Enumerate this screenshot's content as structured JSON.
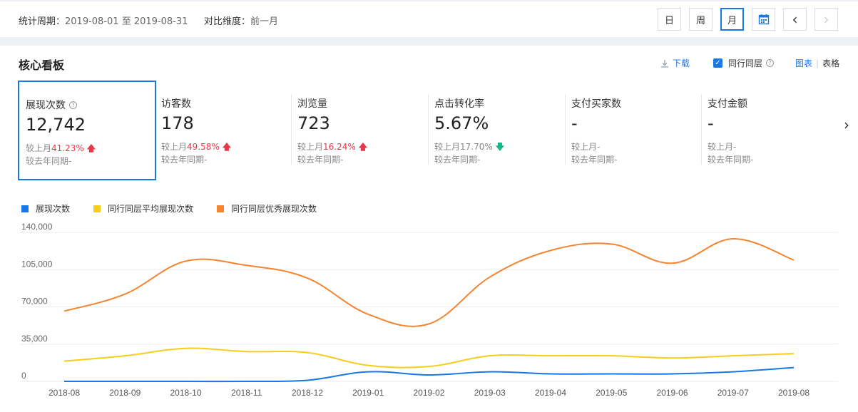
{
  "filters": {
    "period_label": "统计周期：",
    "period_value": "2019-08-01 至 2019-08-31",
    "compare_label": "对比维度：",
    "compare_value": "前一月"
  },
  "toolbar": {
    "day": "日",
    "week": "周",
    "month": "月",
    "prev": "‹",
    "next": "›"
  },
  "panel": {
    "title": "核心看板",
    "download": "下载",
    "peer_label": "同行同层",
    "view_chart": "图表",
    "view_sep": "|",
    "view_table": "表格"
  },
  "cards": [
    {
      "title": "展现次数",
      "value": "12,742",
      "mom_label": "较上月",
      "mom_pct": "41.23%",
      "trend": "up",
      "yoy_label": "较去年同期",
      "yoy_value": "-"
    },
    {
      "title": "访客数",
      "value": "178",
      "mom_label": "较上月",
      "mom_pct": "49.58%",
      "trend": "up",
      "yoy_label": "较去年同期",
      "yoy_value": "-"
    },
    {
      "title": "浏览量",
      "value": "723",
      "mom_label": "较上月",
      "mom_pct": "16.24%",
      "trend": "up",
      "yoy_label": "较去年同期",
      "yoy_value": "-"
    },
    {
      "title": "点击转化率",
      "value": "5.67%",
      "mom_label": "较上月",
      "mom_pct": "17.70%",
      "trend": "down",
      "yoy_label": "较去年同期",
      "yoy_value": "-"
    },
    {
      "title": "支付买家数",
      "value": "-",
      "mom_label": "较上月",
      "mom_pct": "-",
      "trend": "none",
      "yoy_label": "较去年同期",
      "yoy_value": "-"
    },
    {
      "title": "支付金额",
      "value": "-",
      "mom_label": "较上月",
      "mom_pct": "-",
      "trend": "none",
      "yoy_label": "较去年同期",
      "yoy_value": "-"
    }
  ],
  "colors": {
    "accent": "#1a78e6",
    "up": "#e8394a",
    "down": "#17b58a",
    "series1": "#1a78e6",
    "series2": "#f5cd1d",
    "series3": "#f5832f"
  },
  "chart_data": {
    "type": "line",
    "x": [
      "2018-08",
      "2018-09",
      "2018-10",
      "2018-11",
      "2018-12",
      "2019-01",
      "2019-02",
      "2019-03",
      "2019-04",
      "2019-05",
      "2019-06",
      "2019-07",
      "2019-08"
    ],
    "yticks": [
      "0",
      "35,000",
      "70,000",
      "105,000",
      "140,000"
    ],
    "ylim": [
      0,
      140000
    ],
    "grid": true,
    "legend_position": "top-left",
    "series": [
      {
        "name": "展现次数",
        "color": "#1a78e6",
        "values": [
          0,
          0,
          0,
          0,
          1000,
          9000,
          6000,
          9000,
          7000,
          7000,
          7000,
          9000,
          13000
        ]
      },
      {
        "name": "同行同层平均展现次数",
        "color": "#f5cd1d",
        "values": [
          19000,
          24000,
          31000,
          28000,
          27000,
          15000,
          14000,
          24000,
          24000,
          24000,
          22000,
          24000,
          26000
        ]
      },
      {
        "name": "同行同层优秀展现次数",
        "color": "#f5832f",
        "values": [
          66000,
          82000,
          113000,
          109000,
          97000,
          63000,
          54000,
          98000,
          123000,
          129000,
          111000,
          134000,
          114000
        ]
      }
    ]
  }
}
